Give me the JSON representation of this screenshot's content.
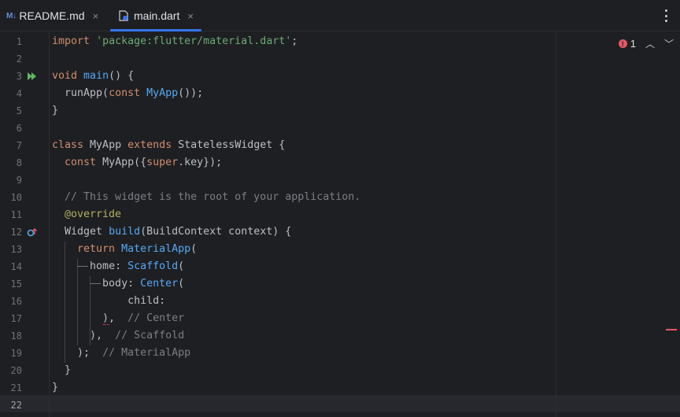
{
  "tabs": [
    {
      "label": "README.md",
      "icon": "markdown-icon",
      "icon_text": "M↓",
      "close": "×"
    },
    {
      "label": "main.dart",
      "icon": "dart-file-icon",
      "close": "×",
      "active": true
    }
  ],
  "accent_color": "#3574f0",
  "error_color": "#e55765",
  "inspection": {
    "error_count": "1",
    "error_icon": "!"
  },
  "line_numbers": [
    "1",
    "2",
    "3",
    "4",
    "5",
    "6",
    "7",
    "8",
    "9",
    "10",
    "11",
    "12",
    "13",
    "14",
    "15",
    "16",
    "17",
    "18",
    "19",
    "20",
    "21",
    "22"
  ],
  "code": {
    "l1": {
      "kw": "import",
      "str": "'package:flutter/material.dart'",
      "end": ";"
    },
    "l3": {
      "kw": "void",
      "fn": "main",
      "end": "() {"
    },
    "l4": {
      "a": "runApp(",
      "kw": "const",
      "cls": "MyApp",
      "end": "());"
    },
    "l5": "}",
    "l7": {
      "kw1": "class",
      "name": "MyApp",
      "kw2": "extends",
      "base": "StatelessWidget {"
    },
    "l8": {
      "kw": "const",
      "a": "MyApp({",
      "kw2": "super",
      "end": ".key});"
    },
    "l10": "// This widget is the root of your application.",
    "l11": "@override",
    "l12": {
      "a": "Widget",
      "fn": "build",
      "end": "(BuildContext context) {"
    },
    "l13": {
      "kw": "return",
      "cls": "MaterialApp",
      "end": "("
    },
    "l14": {
      "name": "home:",
      "cls": "Scaffold",
      "end": "("
    },
    "l15": {
      "name": "body:",
      "cls": "Center",
      "end": "("
    },
    "l16": "child:",
    "l17": {
      "a": "),",
      "cmt": "// Center"
    },
    "l18": {
      "a": "),",
      "cmt": "// Scaffold"
    },
    "l19": {
      "a": ");",
      "cmt": "// MaterialApp"
    },
    "l20": "}",
    "l21": "}"
  }
}
